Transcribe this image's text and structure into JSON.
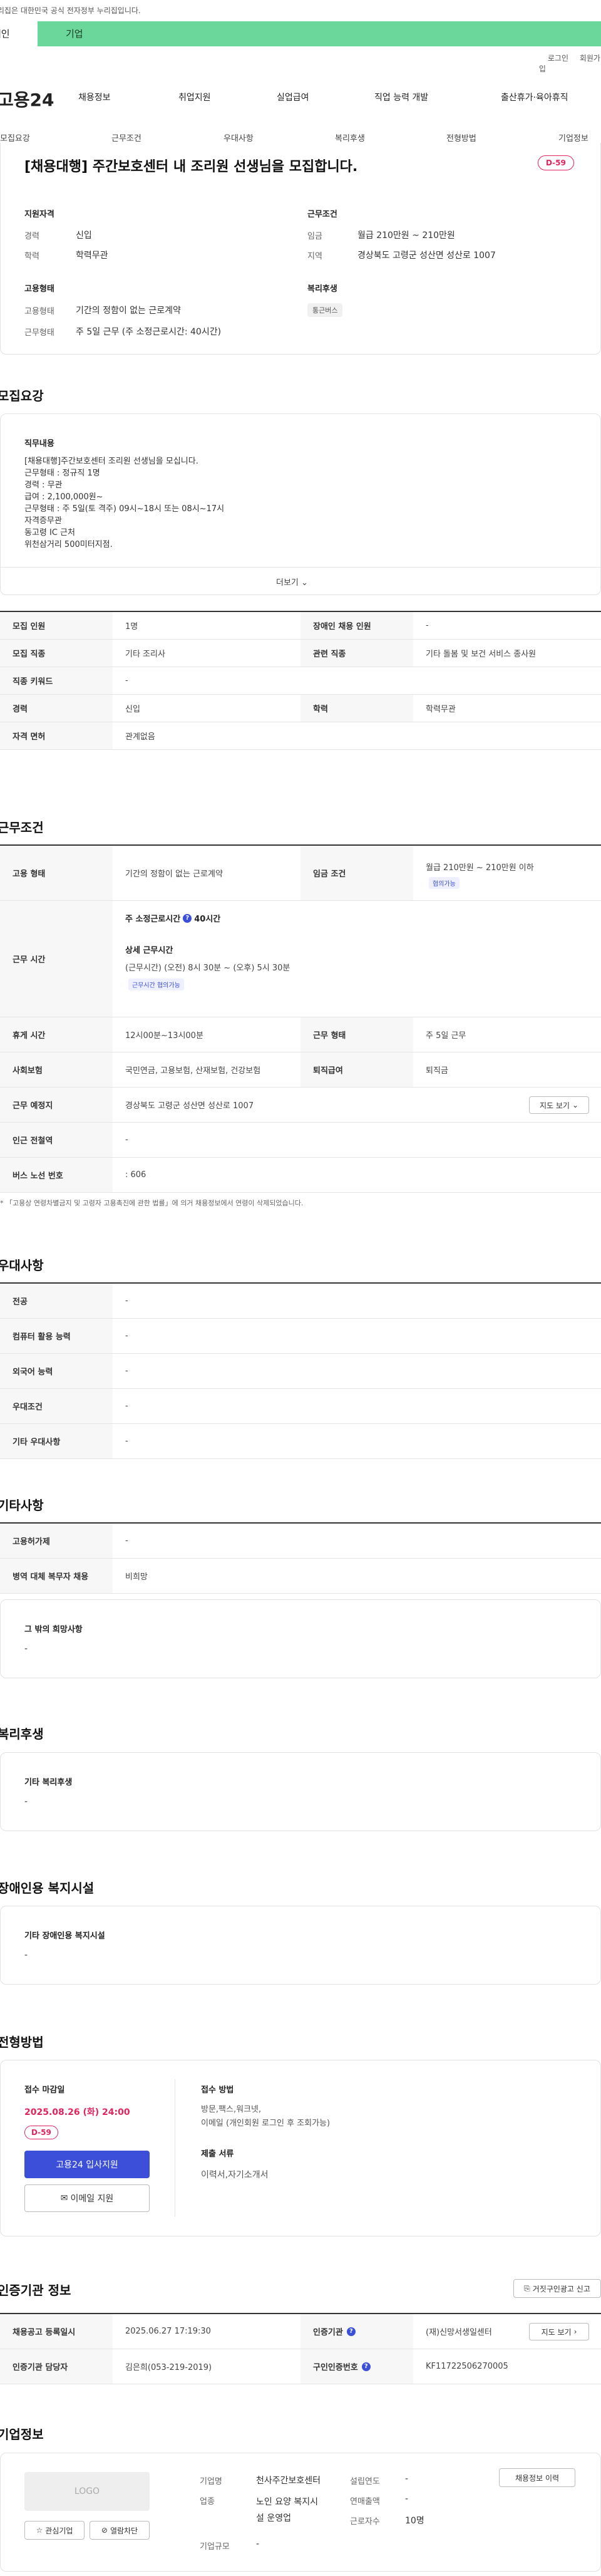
{
  "gov_notice": "이 누리집은 대한민국 공식 전자정부 누리집입니다.",
  "user_tabs": [
    "개인",
    "기업"
  ],
  "util": [
    "로그인",
    "회원가입"
  ],
  "logo": "고용24",
  "gnb": [
    "채용정보",
    "취업지원",
    "실업급여",
    "직업 능력 개발",
    "출산휴가·육아휴직"
  ],
  "subnav": [
    "모집요강",
    "근무조건",
    "우대사항",
    "복리후생",
    "전형방법",
    "기업정보"
  ],
  "summary": {
    "title": "[채용대행] 주간보호센터 내 조리원 선생님을 모집합니다.",
    "dday": "D-59",
    "qual_h": "지원자격",
    "qual": [
      [
        "경력",
        "신입"
      ],
      [
        "학력",
        "학력무관"
      ]
    ],
    "cond_h": "근무조건",
    "cond": [
      [
        "임금",
        "월급 210만원 ~ 210만원"
      ],
      [
        "지역",
        "경상북도 고령군 성산면 성산로 1007"
      ]
    ],
    "emp_h": "고용형태",
    "emp": [
      [
        "고용형태",
        "기간의 정함이 없는 근로계약"
      ],
      [
        "근무형태",
        "주 5일 근무 (주 소정근로시간: 40시간)"
      ]
    ],
    "welfare_h": "복리후생",
    "welfare_chip": "통근버스"
  },
  "recruit": {
    "heading": "모집요강",
    "duty_h": "직무내용",
    "duty": "[채용대행]주간보호센터 조리원 선생님을 모십니다.\n근무형태 : 정규직  1명\n경력 : 무관\n급여 : 2,100,000원~\n근무형태 : 주 5일(토 격주) 09시~18시 또는 08시~17시\n자격증무관\n동고령 IC 근처\n위천삼거리 500미터지점.",
    "more": "더보기",
    "rows": [
      {
        "l1": "모집 인원",
        "v1": "1명",
        "l2": "장애인 채용 인원",
        "v2": "-"
      },
      {
        "l1": "모집 직종",
        "v1": "기타 조리사",
        "l2": "관련 직종",
        "v2": "기타 돌봄 및 보건 서비스 종사원"
      },
      {
        "l1": "직종 키워드",
        "v1": "-"
      },
      {
        "l1": "경력",
        "v1": "신입",
        "l2": "학력",
        "v2": "학력무관"
      },
      {
        "l1": "자격 면허",
        "v1": "관계없음"
      }
    ]
  },
  "work": {
    "heading": "근무조건",
    "emp_type_l": "고용 형태",
    "emp_type_v": "기간의 정함이 없는 근로계약",
    "wage_l": "임금 조건",
    "wage_v": "월급 210만원 ~ 210만원 이하",
    "wage_chip": "협의가능",
    "hours_l": "근무 시간",
    "weekly": "주 소정근로시간",
    "weekly_v": "40시간",
    "detail_h": "상세 근무시간",
    "detail_v": "(근무시간) (오전) 8시 30분 ~ (오후) 5시 30분",
    "detail_chip": "근무시간 협의가능",
    "rest_l": "휴게 시간",
    "rest_v": "12시00분~13시00분",
    "form_l": "근무 형태",
    "form_v": "주 5일 근무",
    "ins_l": "사회보험",
    "ins_v": "국민연금, 고용보험, 산재보험, 건강보험",
    "sev_l": "퇴직급여",
    "sev_v": "퇴직금",
    "place_l": "근무 예정지",
    "place_v": "경상북도 고령군 성산면 성산로 1007",
    "map_btn": "지도 보기",
    "subway_l": "인근 전철역",
    "subway_v": "-",
    "bus_l": "버스 노선 번호",
    "bus_v": ": 606",
    "notice": "* 「고용상 연령차별금지 및 고령자 고용촉진에 관한 법률」에 의거 채용정보에서 연령이 삭제되었습니다."
  },
  "pref": {
    "heading": "우대사항",
    "rows": [
      [
        "전공",
        "-"
      ],
      [
        "컴퓨터 활용 능력",
        "-"
      ],
      [
        "외국어 능력",
        "-"
      ],
      [
        "우대조건",
        "-"
      ],
      [
        "기타 우대사항",
        "-"
      ]
    ]
  },
  "etc": {
    "heading": "기타사항",
    "rows": [
      [
        "고용허가제",
        "-"
      ],
      [
        "병역 대체 복무자 채용",
        "비희망"
      ]
    ],
    "hope_h": "그 밖의 희망사항",
    "hope_v": "-"
  },
  "welfare": {
    "heading": "복리후생",
    "box_h": "기타 복리후생",
    "box_v": "-"
  },
  "disabled": {
    "heading": "장애인용 복지시설",
    "box_h": "기타 장애인용 복지시설",
    "box_v": "-"
  },
  "screen": {
    "heading": "전형방법",
    "deadline_h": "접수 마감일",
    "deadline": "2025.08.26 (화) 24:00",
    "dday": "D-59",
    "apply_btn": "고용24 입사지원",
    "email_btn": "이메일 지원",
    "method_h": "접수 방법",
    "method": "방문,팩스,워크넷,\n이메일 (개인회원 로그인 후 조회가능)",
    "docs_h": "제출 서류",
    "docs": "이력서,자기소개서"
  },
  "cert": {
    "heading": "인증기관 정보",
    "report_btn": "거짓구인광고 신고",
    "r1": {
      "l1": "채용공고 등록일시",
      "v1": "2025.06.27 17:19:30",
      "l2": "인증기관",
      "v2": "(재)신망서생일센터",
      "btn": "지도 보기"
    },
    "r2": {
      "l1": "인증기관 담당자",
      "v1": "김은희(053-219-2019)",
      "l2": "구인인증번호",
      "v2": "KF11722506270005"
    }
  },
  "company": {
    "heading": "기업정보",
    "logo": "LOGO",
    "fav_btn": "관심기업",
    "block_btn": "열람차단",
    "name_l": "기업명",
    "name_v": "천사주간보호센터",
    "ind_l": "업종",
    "ind_v": "노인 요양 복지시설 운영업",
    "size_l": "기업규모",
    "size_v": "-",
    "est_l": "설립연도",
    "est_v": "-",
    "sales_l": "연매출액",
    "sales_v": "-",
    "emp_l": "근로자수",
    "emp_v": "10명",
    "hist_btn": "채용정보 이력"
  },
  "colors": {
    "brand_green": "#6bd79a",
    "accent_blue": "#3b4fd8",
    "dday_red": "#e0245e"
  }
}
